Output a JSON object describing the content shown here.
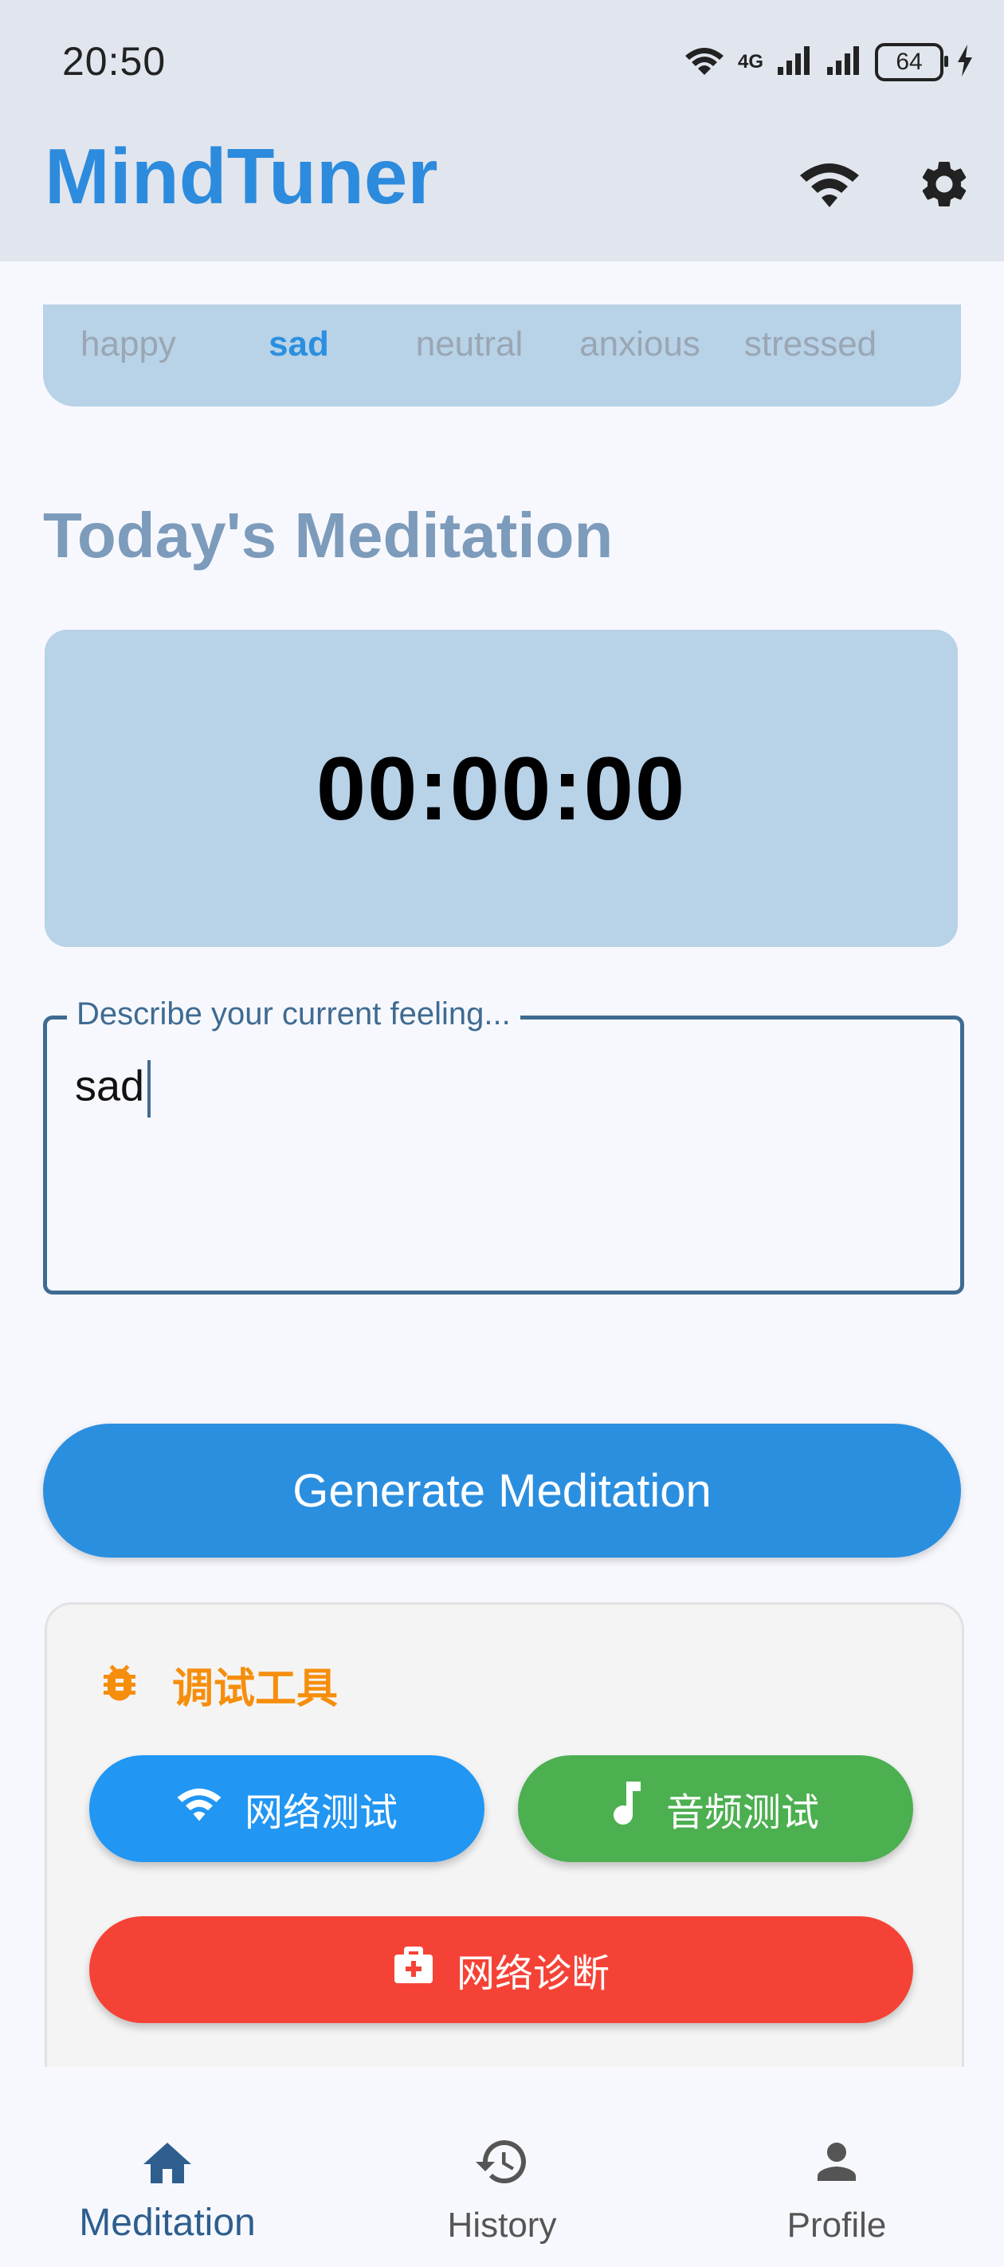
{
  "status": {
    "time": "20:50",
    "network": "4G",
    "battery": "64"
  },
  "app": {
    "title": "MindTuner"
  },
  "moods": [
    {
      "label": "happy",
      "active": false
    },
    {
      "label": "sad",
      "active": true
    },
    {
      "label": "neutral",
      "active": false
    },
    {
      "label": "anxious",
      "active": false
    },
    {
      "label": "stressed",
      "active": false
    }
  ],
  "section": {
    "title": "Today's Meditation"
  },
  "timer": {
    "value": "00:00:00"
  },
  "feeling": {
    "label": "Describe your current feeling...",
    "value": "sad"
  },
  "generate": {
    "label": "Generate Meditation"
  },
  "debug": {
    "title": "调试工具",
    "network_test": "网络测试",
    "audio_test": "音频测试",
    "diagnose": "网络诊断"
  },
  "nav": {
    "meditation": "Meditation",
    "history": "History",
    "profile": "Profile"
  },
  "colors": {
    "brand": "#2c8bdd",
    "mood_bar": "#b8d2e8",
    "debug_orange": "#f68e0d",
    "btn_blue": "#2196f3",
    "btn_green": "#4caf50",
    "btn_red": "#f44336",
    "nav_active": "#2d5e8e"
  }
}
